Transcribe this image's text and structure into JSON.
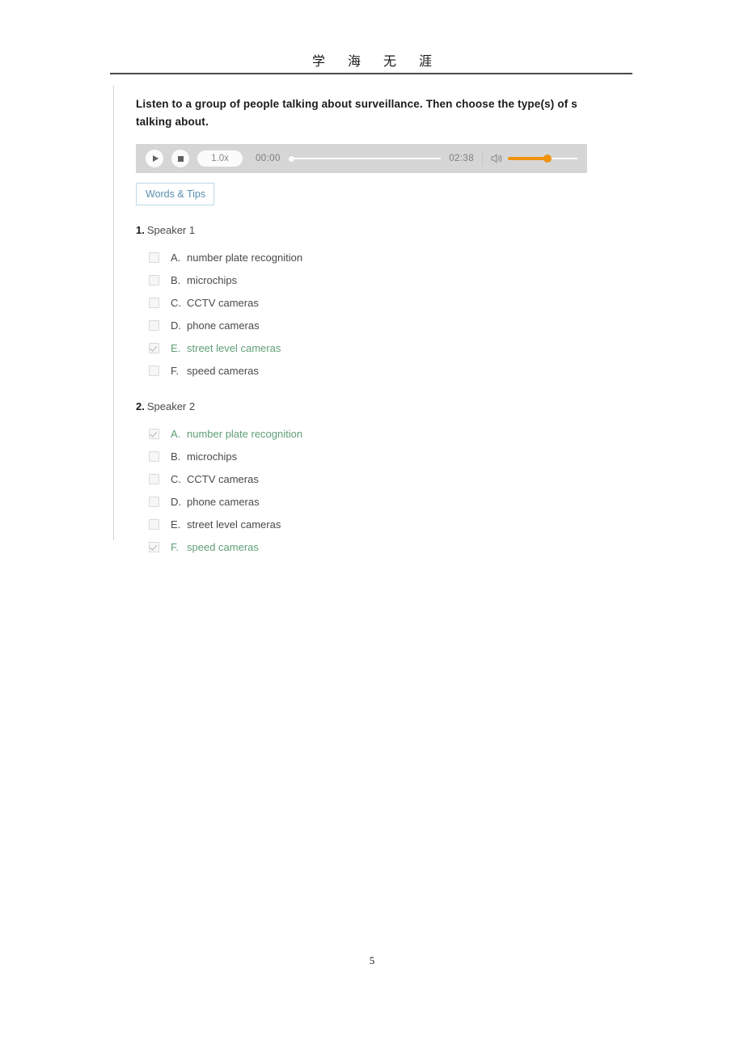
{
  "header": {
    "watermark": "学 海 无 涯"
  },
  "prompt": {
    "line1": "Listen to a group of people talking about surveillance. Then choose the type(s) of s",
    "line2": "talking about."
  },
  "player": {
    "play_label": "play",
    "stop_label": "stop",
    "speed": "1.0x",
    "current_time": "00:00",
    "duration": "02:38",
    "volume_icon": "speaker-icon",
    "accent_color": "#f0920a",
    "background_color": "#d6d6d6"
  },
  "words_tips": {
    "label": "Words & Tips",
    "border_color": "#bcd9ea",
    "text_color": "#5b8fb0"
  },
  "selected_color": "#5f9e77",
  "questions": [
    {
      "number": "1.",
      "title": "Speaker 1",
      "options": [
        {
          "letter": "A.",
          "text": "number plate recognition",
          "checked": false
        },
        {
          "letter": "B.",
          "text": "microchips",
          "checked": false
        },
        {
          "letter": "C.",
          "text": "CCTV cameras",
          "checked": false
        },
        {
          "letter": "D.",
          "text": "phone cameras",
          "checked": false
        },
        {
          "letter": "E.",
          "text": "street level cameras",
          "checked": true
        },
        {
          "letter": "F.",
          "text": "speed cameras",
          "checked": false
        }
      ]
    },
    {
      "number": "2.",
      "title": "Speaker 2",
      "options": [
        {
          "letter": "A.",
          "text": "number plate recognition",
          "checked": true
        },
        {
          "letter": "B.",
          "text": "microchips",
          "checked": false
        },
        {
          "letter": "C.",
          "text": "CCTV cameras",
          "checked": false
        },
        {
          "letter": "D.",
          "text": "phone cameras",
          "checked": false
        },
        {
          "letter": "E.",
          "text": "street level cameras",
          "checked": false
        },
        {
          "letter": "F.",
          "text": "speed cameras",
          "checked": true
        }
      ]
    }
  ],
  "footer": {
    "page_number": "5"
  }
}
